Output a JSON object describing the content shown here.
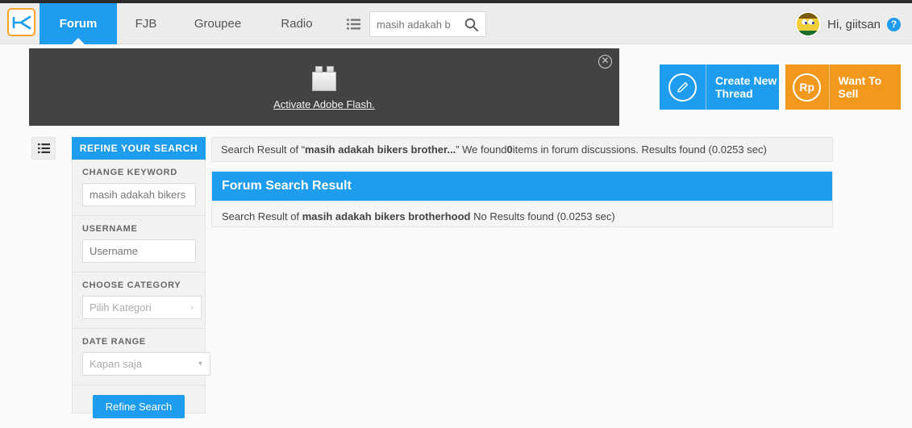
{
  "colors": {
    "accent_blue": "#1e9ced",
    "accent_orange": "#f2981d",
    "logo_border": "#f8a22b",
    "navbar_bg": "#ececec",
    "flash_bg": "#444344",
    "panel_bg": "#f2f2f2",
    "page_bg": "#fafafa"
  },
  "navbar": {
    "logo_name": "kaskus-logo",
    "tabs": [
      {
        "label": "Forum",
        "active": true
      },
      {
        "label": "FJB",
        "active": false
      },
      {
        "label": "Groupee",
        "active": false
      },
      {
        "label": "Radio",
        "active": false
      }
    ],
    "list_icon": "list-ul-icon",
    "search": {
      "value": "masih adakah b",
      "placeholder": "masih adakah b",
      "button_icon": "search-icon"
    },
    "user": {
      "greeting": "Hi, giitsan",
      "avatar_name": "user-avatar",
      "help_label": "?"
    }
  },
  "flash_banner": {
    "activate_link": "Activate Adobe Flash.",
    "close_label": "✕",
    "plugin_icon": "flash-plugin-icon"
  },
  "actions": {
    "create_thread": {
      "label_line1": "Create New",
      "label_line2": "Thread",
      "icon": "pencil-icon"
    },
    "want_to_sell": {
      "label": "Want To Sell",
      "icon": "rupiah-icon",
      "icon_text": "Rp"
    }
  },
  "sidebar": {
    "toggle_icon": "list-toggle-icon",
    "tab_label": "REFINE YOUR SEARCH",
    "groups": [
      {
        "label": "CHANGE KEYWORD",
        "control": "input",
        "name": "change-keyword-input",
        "value": "",
        "placeholder": "masih adakah bikers"
      },
      {
        "label": "USERNAME",
        "control": "input",
        "name": "username-input",
        "value": "",
        "placeholder": "Username"
      },
      {
        "label": "CHOOSE CATEGORY",
        "control": "select",
        "name": "category-select",
        "value": "Pilih Kategori",
        "caret": "›"
      },
      {
        "label": "DATE RANGE",
        "control": "select",
        "name": "daterange-select",
        "value": "Kapan saja",
        "caret": "▾"
      }
    ],
    "submit_label": "Refine Search"
  },
  "main": {
    "summary": {
      "prefix": "Search Result of “",
      "query": "masih adakah bikers brother...",
      "mid": "” We found ",
      "count": "0",
      "suffix": " items in forum discussions. Results found (0.0253 sec)"
    },
    "result_panel": {
      "title": "Forum Search Result",
      "body_prefix": "Search Result of ",
      "body_query": "masih adakah bikers brotherhood",
      "body_suffix": " No Results found (0.0253 sec)"
    }
  }
}
